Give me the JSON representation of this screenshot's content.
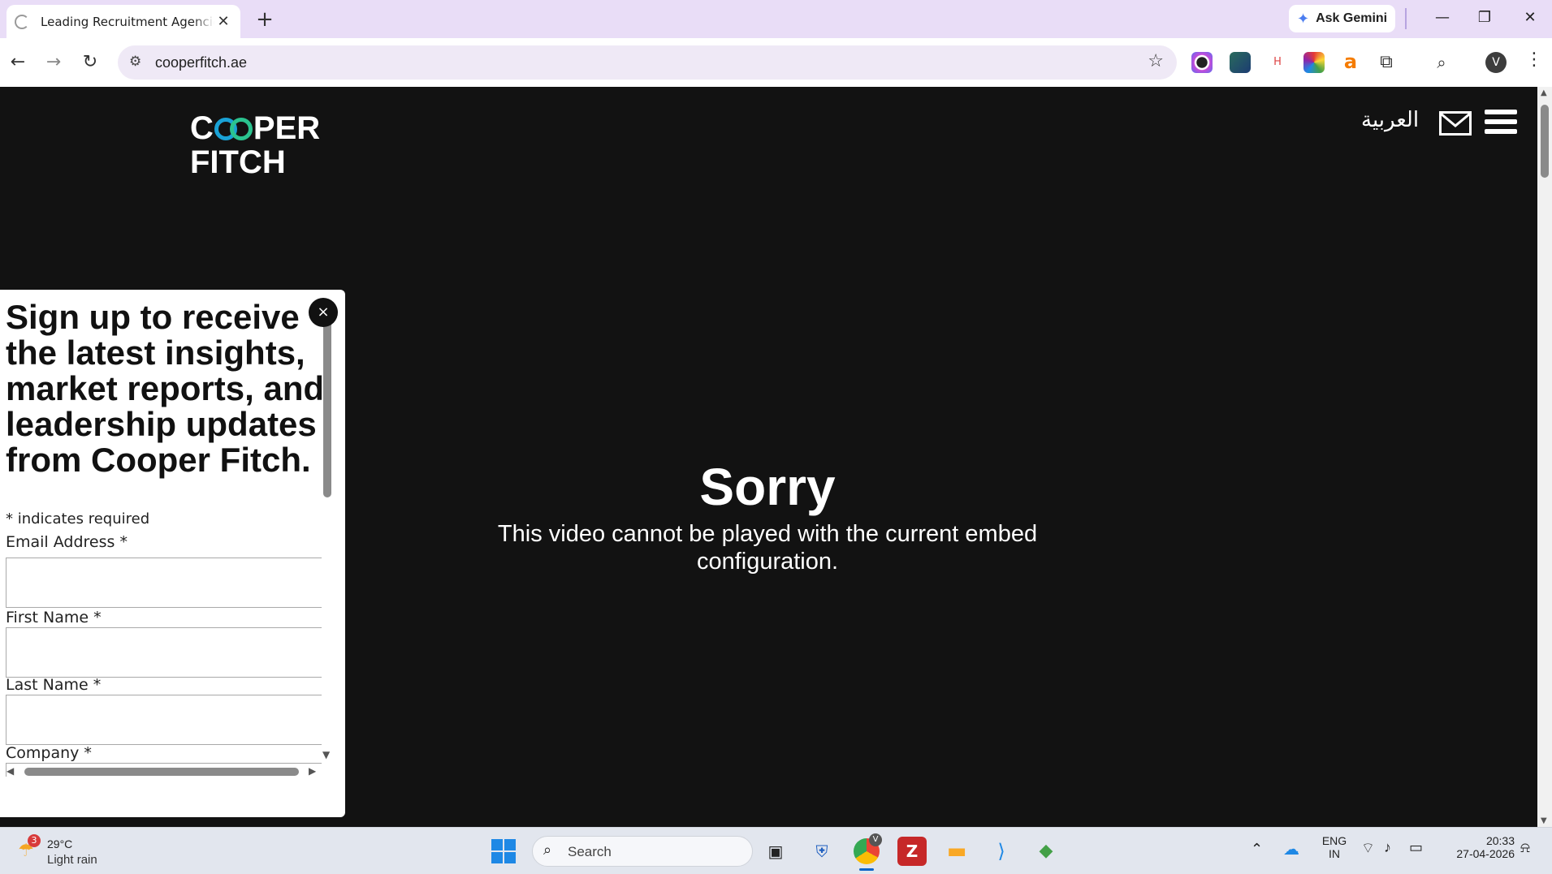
{
  "browser": {
    "tab_title": "Leading Recruitment Agencies in",
    "tab_close": "✕",
    "new_tab": "+",
    "ask_gemini": "Ask Gemini",
    "url": "cooperfitch.ae",
    "profile_initial": "V",
    "window_controls": {
      "minimize": "—",
      "restore": "❐",
      "close": "✕"
    }
  },
  "site": {
    "logo_line1_a": "C",
    "logo_line1_b": "PER",
    "logo_line2": "FITCH",
    "language_link": "العربية",
    "video_error_title": "Sorry",
    "video_error_message": "This video cannot be played with the current embed configuration."
  },
  "signup_popup": {
    "heading": "Sign up to receive the latest insights, market reports, and leadership updates from Cooper Fitch.",
    "required_note": "* indicates required",
    "close_label": "×",
    "fields": [
      {
        "label": "Email Address *",
        "value": ""
      },
      {
        "label": "First Name *",
        "value": ""
      },
      {
        "label": "Last Name *",
        "value": ""
      },
      {
        "label": "Company *",
        "value": ""
      }
    ]
  },
  "taskbar": {
    "weather_badge": "3",
    "weather_temp": "29°C",
    "weather_condition": "Light rain",
    "search_label": "Search",
    "language_line1": "ENG",
    "language_line2": "IN",
    "time": "20:33",
    "date": "27-04-2026",
    "chrome_profile_badge": "V"
  },
  "colors": {
    "page_background": "#121212",
    "tabstrip_background": "#e9ddf7",
    "logo_ring_blue": "#1aa2d6",
    "logo_ring_green": "#2bc38f"
  }
}
